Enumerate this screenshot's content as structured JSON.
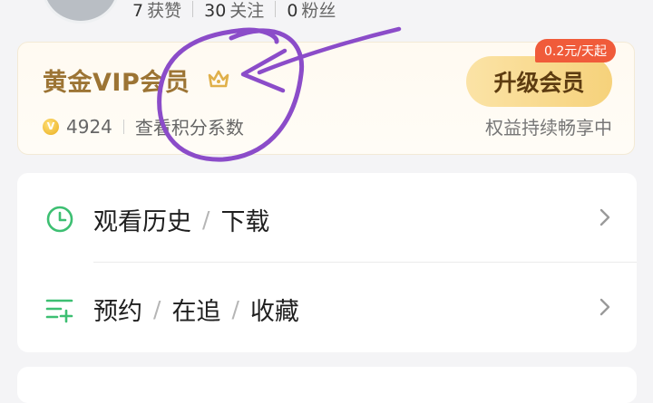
{
  "profile": {
    "stats": [
      {
        "count": "7",
        "label": "获赞"
      },
      {
        "count": "30",
        "label": "关注"
      },
      {
        "count": "0",
        "label": "粉丝"
      }
    ]
  },
  "vip": {
    "title": "黄金VIP会员",
    "icon": "crown-icon",
    "points_value": "4924",
    "points_link": "查看积分系数",
    "upgrade_button": "升级会员",
    "price_badge": "0.2元/天起",
    "benefit_text": "权益持续畅享中",
    "colors": {
      "gold": "#9c7434",
      "badge": "#f05b3a",
      "button": "#f6d27b"
    }
  },
  "menu": {
    "items": [
      {
        "icon": "clock-icon",
        "parts": [
          "观看历史",
          "下载"
        ]
      },
      {
        "icon": "list-add-icon",
        "parts": [
          "预约",
          "在追",
          "收藏"
        ]
      }
    ],
    "accent": "#3dbf72"
  },
  "annotation": {
    "color": "#8b4cc9"
  }
}
